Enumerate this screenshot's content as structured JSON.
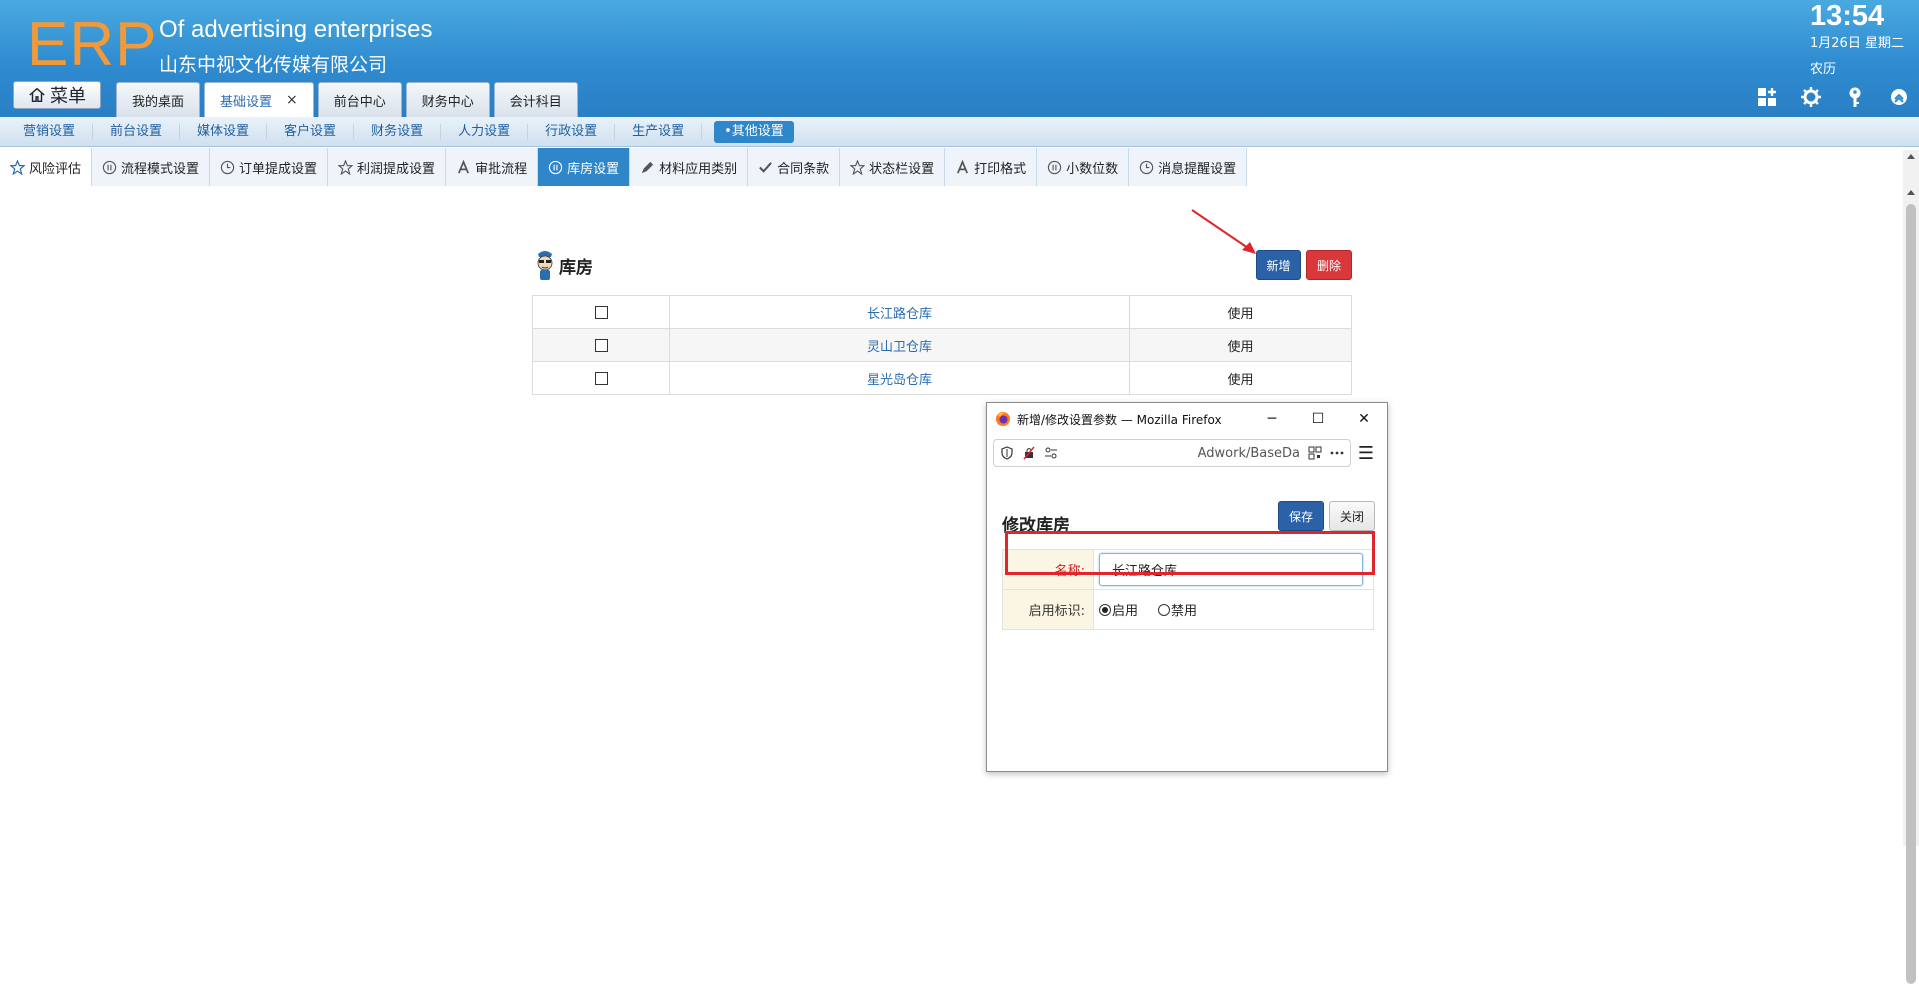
{
  "header": {
    "logo": "ERP",
    "brand_en": "Of advertising enterprises",
    "brand_cn": "山东中视文化传媒有限公司",
    "clock": "13:54",
    "date": "1月26日 星期二",
    "lunar": "农历",
    "menu_label": "菜单",
    "tabs": [
      {
        "label": "我的桌面"
      },
      {
        "label": "基础设置",
        "active": true,
        "close": "×"
      },
      {
        "label": "前台中心"
      },
      {
        "label": "财务中心"
      },
      {
        "label": "会计科目"
      }
    ]
  },
  "subnav": {
    "items": [
      "营销设置",
      "前台设置",
      "媒体设置",
      "客户设置",
      "财务设置",
      "人力设置",
      "行政设置",
      "生产设置"
    ],
    "active_item": "•其他设置"
  },
  "tabs2": [
    {
      "label": "风险评估",
      "icon": "star-icon"
    },
    {
      "label": "流程模式设置",
      "icon": "pause-circle-icon"
    },
    {
      "label": "订单提成设置",
      "icon": "clock-icon"
    },
    {
      "label": "利润提成设置",
      "icon": "star-icon"
    },
    {
      "label": "审批流程",
      "icon": "letter-a-icon"
    },
    {
      "label": "库房设置",
      "icon": "pause-circle-icon",
      "active": true
    },
    {
      "label": "材料应用类别",
      "icon": "pencil-icon"
    },
    {
      "label": "合同条款",
      "icon": "check-icon"
    },
    {
      "label": "状态栏设置",
      "icon": "star-icon"
    },
    {
      "label": "打印格式",
      "icon": "letter-a-icon"
    },
    {
      "label": "小数位数",
      "icon": "pause-circle-icon"
    },
    {
      "label": "消息提醒设置",
      "icon": "clock-icon"
    }
  ],
  "main": {
    "title": "库房",
    "new_label": "新增",
    "delete_label": "删除",
    "rows": [
      {
        "name": "长江路仓库",
        "status": "使用"
      },
      {
        "name": "灵山卫仓库",
        "status": "使用"
      },
      {
        "name": "星光岛仓库",
        "status": "使用"
      }
    ]
  },
  "popup": {
    "window_title": "新增/修改设置参数 — Mozilla Firefox",
    "url_text": "Adwork/BaseDa",
    "heading": "修改库房",
    "save_label": "保存",
    "close_label": "关闭",
    "name_label": "名称:",
    "name_value": "长江路仓库",
    "status_label": "启用标识:",
    "radio_on": "启用",
    "radio_off": "禁用"
  },
  "colors": {
    "header_blue": "#2f8bd0",
    "logo_orange": "#f29a3a",
    "active_tab_blue": "#2f86c9",
    "button_blue": "#2b62a7",
    "button_red": "#d9373a",
    "annotation_red": "#e0262c"
  }
}
